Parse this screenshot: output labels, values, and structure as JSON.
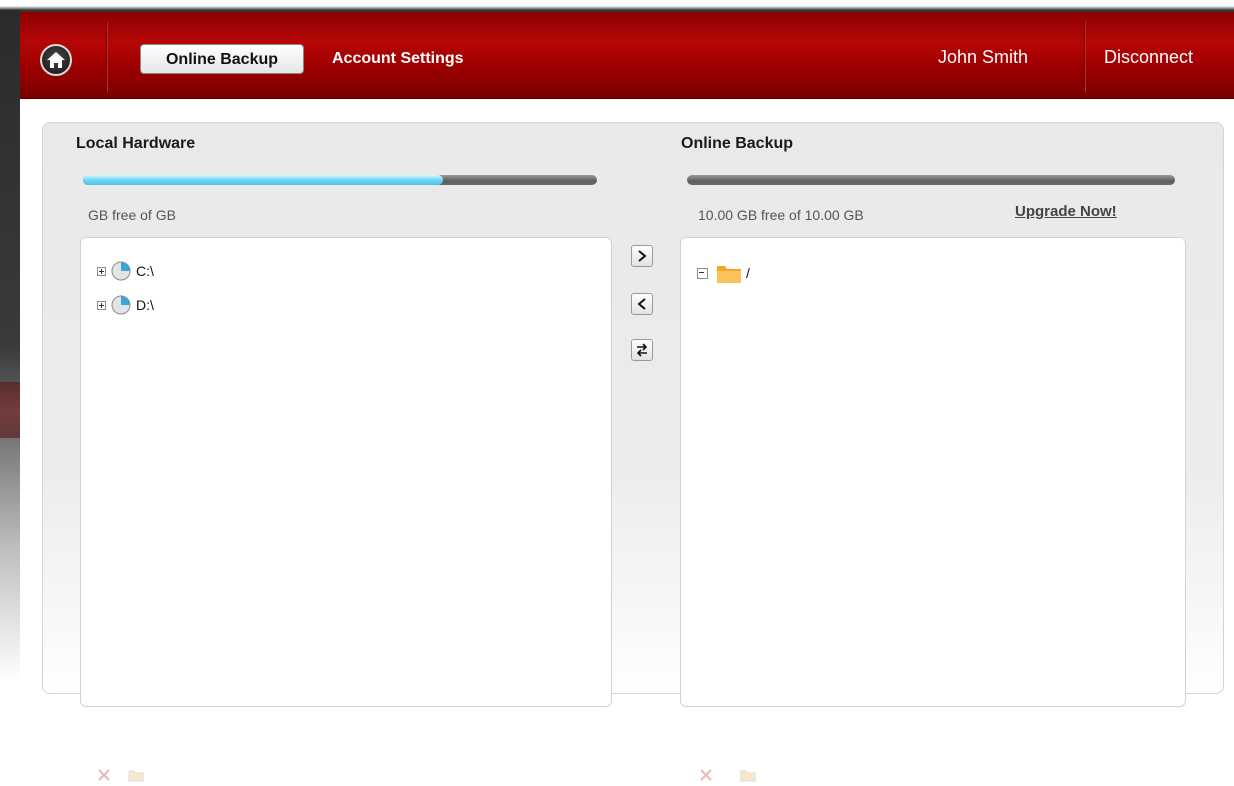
{
  "header": {
    "tabs": [
      {
        "label": "Online Backup",
        "active": true
      },
      {
        "label": "Account Settings",
        "active": false
      }
    ],
    "user_name": "John Smith",
    "disconnect_label": "Disconnect"
  },
  "local": {
    "title": "Local Hardware",
    "usage_fraction": 0.7,
    "free_text": "GB free of   GB",
    "tree": [
      {
        "label": "C:\\",
        "expanded": false,
        "icon": "drive-icon"
      },
      {
        "label": "D:\\",
        "expanded": false,
        "icon": "drive-icon"
      }
    ]
  },
  "online": {
    "title": "Online Backup",
    "usage_fraction": 0.0,
    "free_text": "10.00  GB free of  10.00  GB",
    "upgrade_label": "Upgrade Now!",
    "tree": [
      {
        "label": "/",
        "expanded": true,
        "icon": "folder-icon"
      }
    ]
  },
  "transfer_buttons": [
    "upload-right-icon",
    "download-left-icon",
    "sync-icon"
  ],
  "colors": {
    "header_red": "#a20000",
    "progress_fill": "#6fd7f3",
    "folder_orange": "#f5a623"
  }
}
